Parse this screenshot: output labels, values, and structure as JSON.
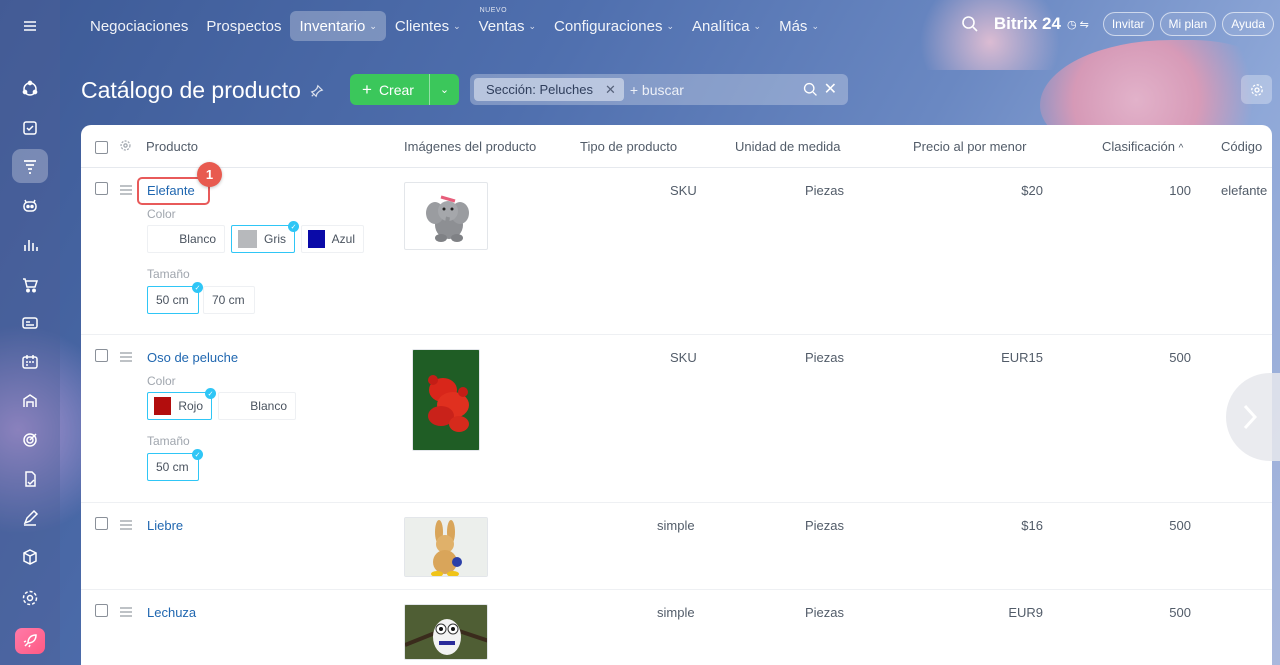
{
  "topnav": {
    "items": [
      {
        "label": "Negociaciones",
        "chev": false
      },
      {
        "label": "Prospectos",
        "chev": false
      },
      {
        "label": "Inventario",
        "chev": true
      },
      {
        "label": "Clientes",
        "chev": true
      },
      {
        "label": "Ventas",
        "chev": true,
        "badge": "NUEVO"
      },
      {
        "label": "Configuraciones",
        "chev": true
      },
      {
        "label": "Analítica",
        "chev": true
      },
      {
        "label": "Más",
        "chev": true
      }
    ],
    "brand": "Bitrix 24",
    "invite": "Invitar",
    "plan": "Mi plan",
    "help": "Ayuda"
  },
  "page": {
    "title": "Catálogo de producto",
    "create_label": "Crear",
    "filter_chip": "Sección: Peluches",
    "search_placeholder": "+ buscar"
  },
  "table": {
    "headers": [
      "Producto",
      "Imágenes del producto",
      "Tipo de producto",
      "Unidad de medida",
      "Precio al por menor",
      "Clasificación",
      "Código"
    ],
    "sort_indicator": "^",
    "rows": [
      {
        "name": "Elefante",
        "type": "SKU",
        "unit": "Piezas",
        "price": "$20",
        "rank": "100",
        "code": "elefante",
        "color_label": "Color",
        "colors": [
          {
            "label": "Blanco",
            "swatch": "#ffffff",
            "selected": false
          },
          {
            "label": "Gris",
            "swatch": "#b7b9bc",
            "selected": true
          },
          {
            "label": "Azul",
            "swatch": "#0a0aa8",
            "selected": false
          }
        ],
        "size_label": "Tamaño",
        "sizes": [
          {
            "label": "50 cm",
            "selected": true
          },
          {
            "label": "70 cm",
            "selected": false
          }
        ]
      },
      {
        "name": "Oso de peluche",
        "type": "SKU",
        "unit": "Piezas",
        "price": "EUR15",
        "rank": "500",
        "code": "",
        "color_label": "Color",
        "colors": [
          {
            "label": "Rojo",
            "swatch": "#b20d0d",
            "selected": true
          },
          {
            "label": "Blanco",
            "swatch": "#ffffff",
            "selected": false
          }
        ],
        "size_label": "Tamaño",
        "sizes": [
          {
            "label": "50 cm",
            "selected": true
          }
        ]
      },
      {
        "name": "Liebre",
        "type": "simple",
        "unit": "Piezas",
        "price": "$16",
        "rank": "500",
        "code": ""
      },
      {
        "name": "Lechuza",
        "type": "simple",
        "unit": "Piezas",
        "price": "EUR9",
        "rank": "500",
        "code": ""
      }
    ]
  },
  "annotation": {
    "number": "1"
  },
  "colors": {
    "accent_green": "#3bc75b",
    "link": "#2067b0",
    "select_blue": "#2fc6f6",
    "badge_red": "#e85a4f"
  },
  "icons": [
    "menu-icon",
    "search-icon",
    "pin-icon",
    "gear-icon",
    "drag-handle-icon",
    "chevron-right-icon"
  ]
}
